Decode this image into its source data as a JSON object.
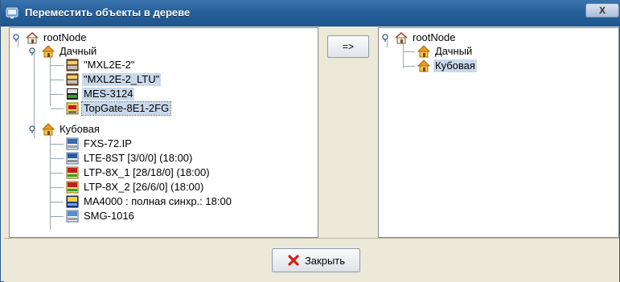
{
  "window": {
    "title": "Переместить объекты в дереве",
    "close_label": "X"
  },
  "left_tree": {
    "root": "rootNode",
    "groups": [
      {
        "label": "Дачный",
        "items": [
          "\"MXL2E-2\"",
          "\"MXL2E-2_LTU\"",
          "MES-3124",
          "TopGate-8E1-2FG"
        ]
      },
      {
        "label": "Кубовая",
        "items": [
          "FXS-72.IP",
          "LTE-8ST [3/0/0] (18:00)",
          "LTP-8X_1 [28/18/0] (18:00)",
          "LTP-8X_2 [26/6/0] (18:00)",
          "MA4000 : полная синхр.: 18:00",
          "SMG-1016"
        ]
      }
    ]
  },
  "right_tree": {
    "root": "rootNode",
    "groups": [
      "Дачный",
      "Кубовая"
    ]
  },
  "buttons": {
    "move_label": "=>",
    "close_label": "Закрыть"
  },
  "colors": {
    "title_bar": "#27609a",
    "selection": "#c9d9ec",
    "background": "#ece9d8"
  }
}
